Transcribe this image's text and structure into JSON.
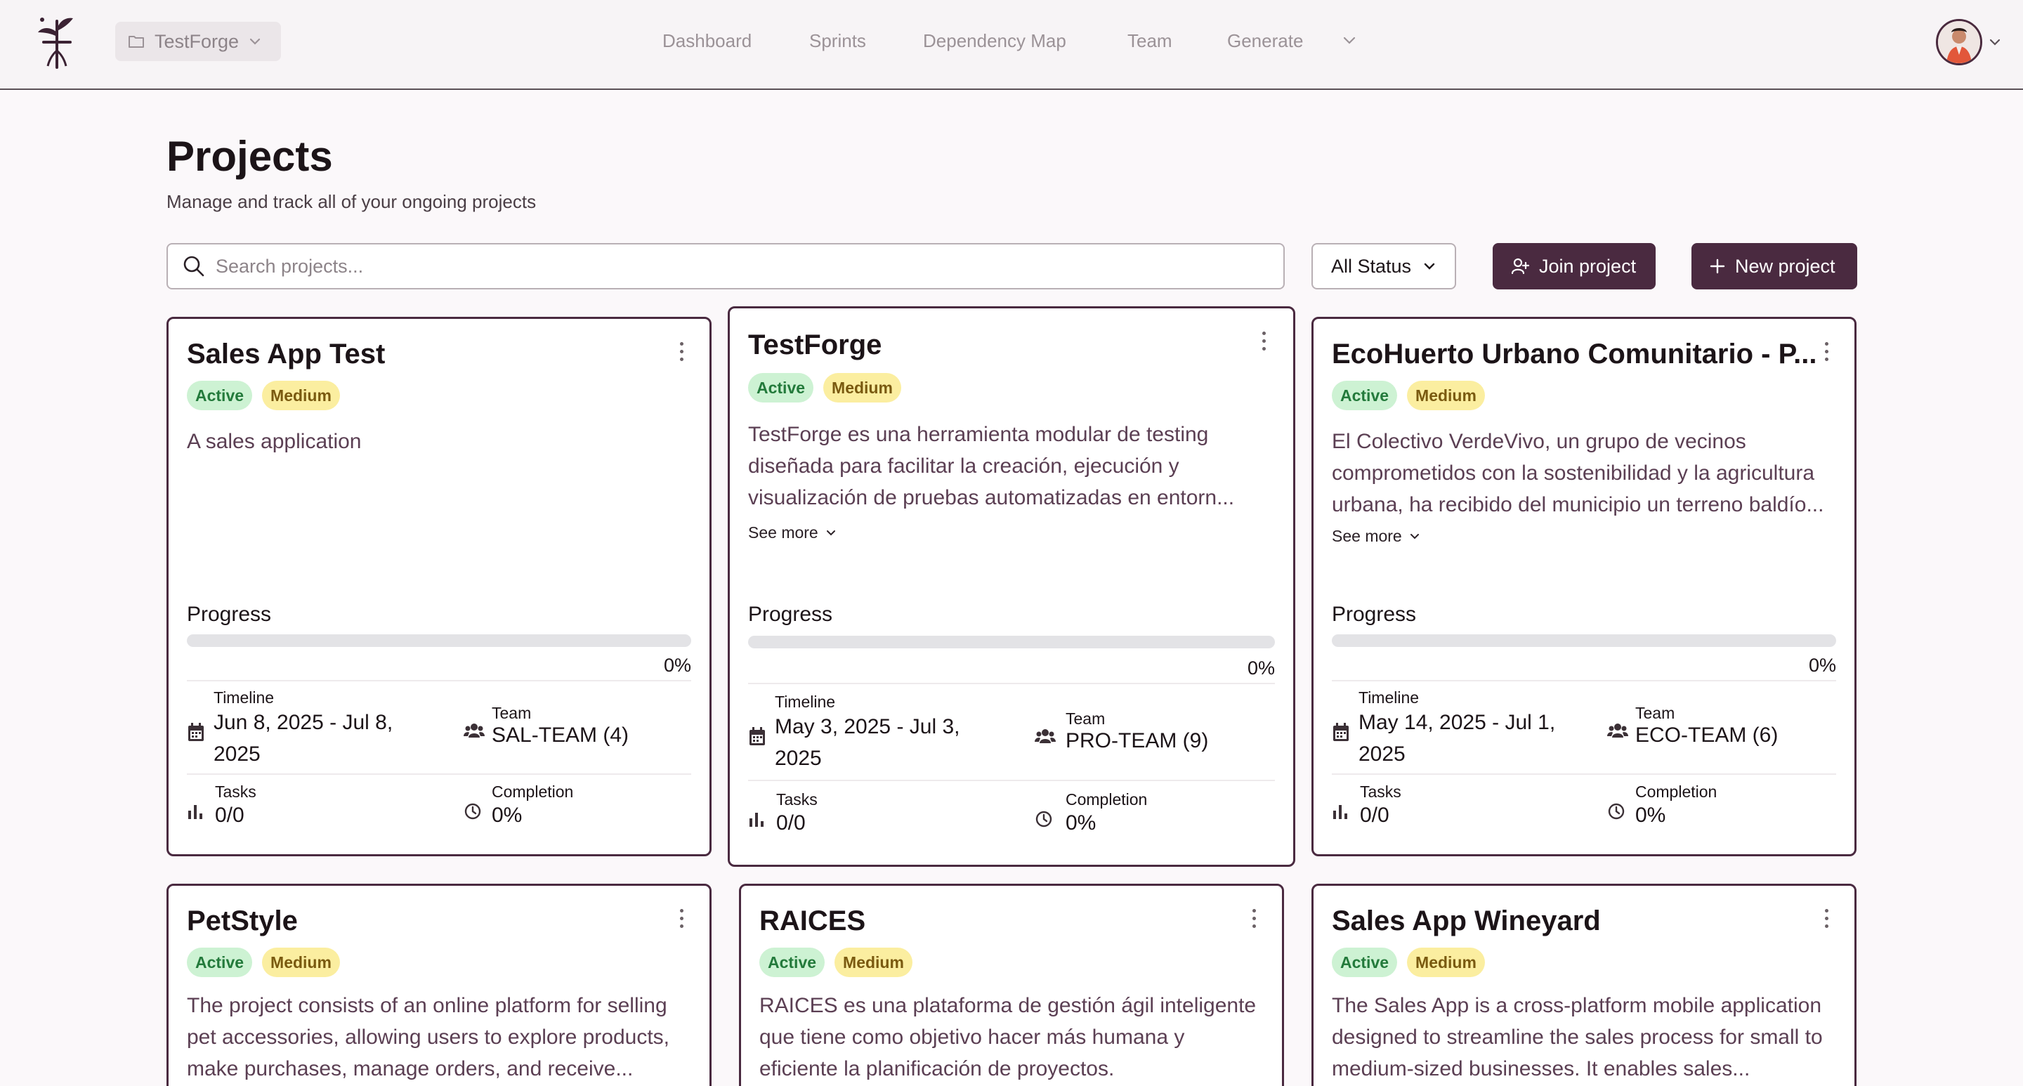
{
  "header": {
    "project_selector": "TestForge",
    "nav": [
      "Dashboard",
      "Sprints",
      "Dependency Map",
      "Team",
      "Generate"
    ]
  },
  "page": {
    "title": "Projects",
    "subtitle": "Manage and track all of your ongoing projects"
  },
  "toolbar": {
    "search_placeholder": "Search projects...",
    "status_filter": "All Status",
    "join_label": "Join project",
    "new_label": "New project"
  },
  "labels": {
    "progress": "Progress",
    "timeline": "Timeline",
    "team": "Team",
    "tasks": "Tasks",
    "completion": "Completion",
    "see_more": "See more"
  },
  "projects": [
    {
      "title": "Sales App Test",
      "status": "Active",
      "priority": "Medium",
      "description": "A sales application",
      "progress": 0,
      "progress_text": "0%",
      "timeline": "Jun 8, 2025 - Jul 8, 2025",
      "team": "SAL-TEAM (4)",
      "tasks": "0/0",
      "completion": "0%"
    },
    {
      "title": "TestForge",
      "status": "Active",
      "priority": "Medium",
      "description": "TestForge es una herramienta modular de testing diseñada para facilitar la creación, ejecución y visualización de pruebas automatizadas en entorn...",
      "progress": 0,
      "progress_text": "0%",
      "timeline": "May 3, 2025 - Jul 3, 2025",
      "team": "PRO-TEAM (9)",
      "tasks": "0/0",
      "completion": "0%"
    },
    {
      "title": "EcoHuerto Urbano Comunitario - P...",
      "status": "Active",
      "priority": "Medium",
      "description": "El Colectivo VerdeVivo, un grupo de vecinos comprometidos con la sostenibilidad y la agricultura urbana, ha recibido del municipio un terreno baldío...",
      "progress": 0,
      "progress_text": "0%",
      "timeline": "May 14, 2025 - Jul 1, 2025",
      "team": "ECO-TEAM (6)",
      "tasks": "0/0",
      "completion": "0%"
    },
    {
      "title": "PetStyle",
      "status": "Active",
      "priority": "Medium",
      "description": "The project consists of an online platform for selling pet accessories, allowing users to explore products, make purchases, manage orders, and receive..."
    },
    {
      "title": "RAICES",
      "status": "Active",
      "priority": "Medium",
      "description": "RAICES es una plataforma de gestión ágil inteligente que tiene como objetivo hacer más humana y eficiente la planificación de proyectos."
    },
    {
      "title": "Sales App Wineyard",
      "status": "Active",
      "priority": "Medium",
      "description": "The Sales App is a cross-platform mobile application designed to streamline the sales process for small to medium-sized businesses. It enables sales..."
    }
  ]
}
